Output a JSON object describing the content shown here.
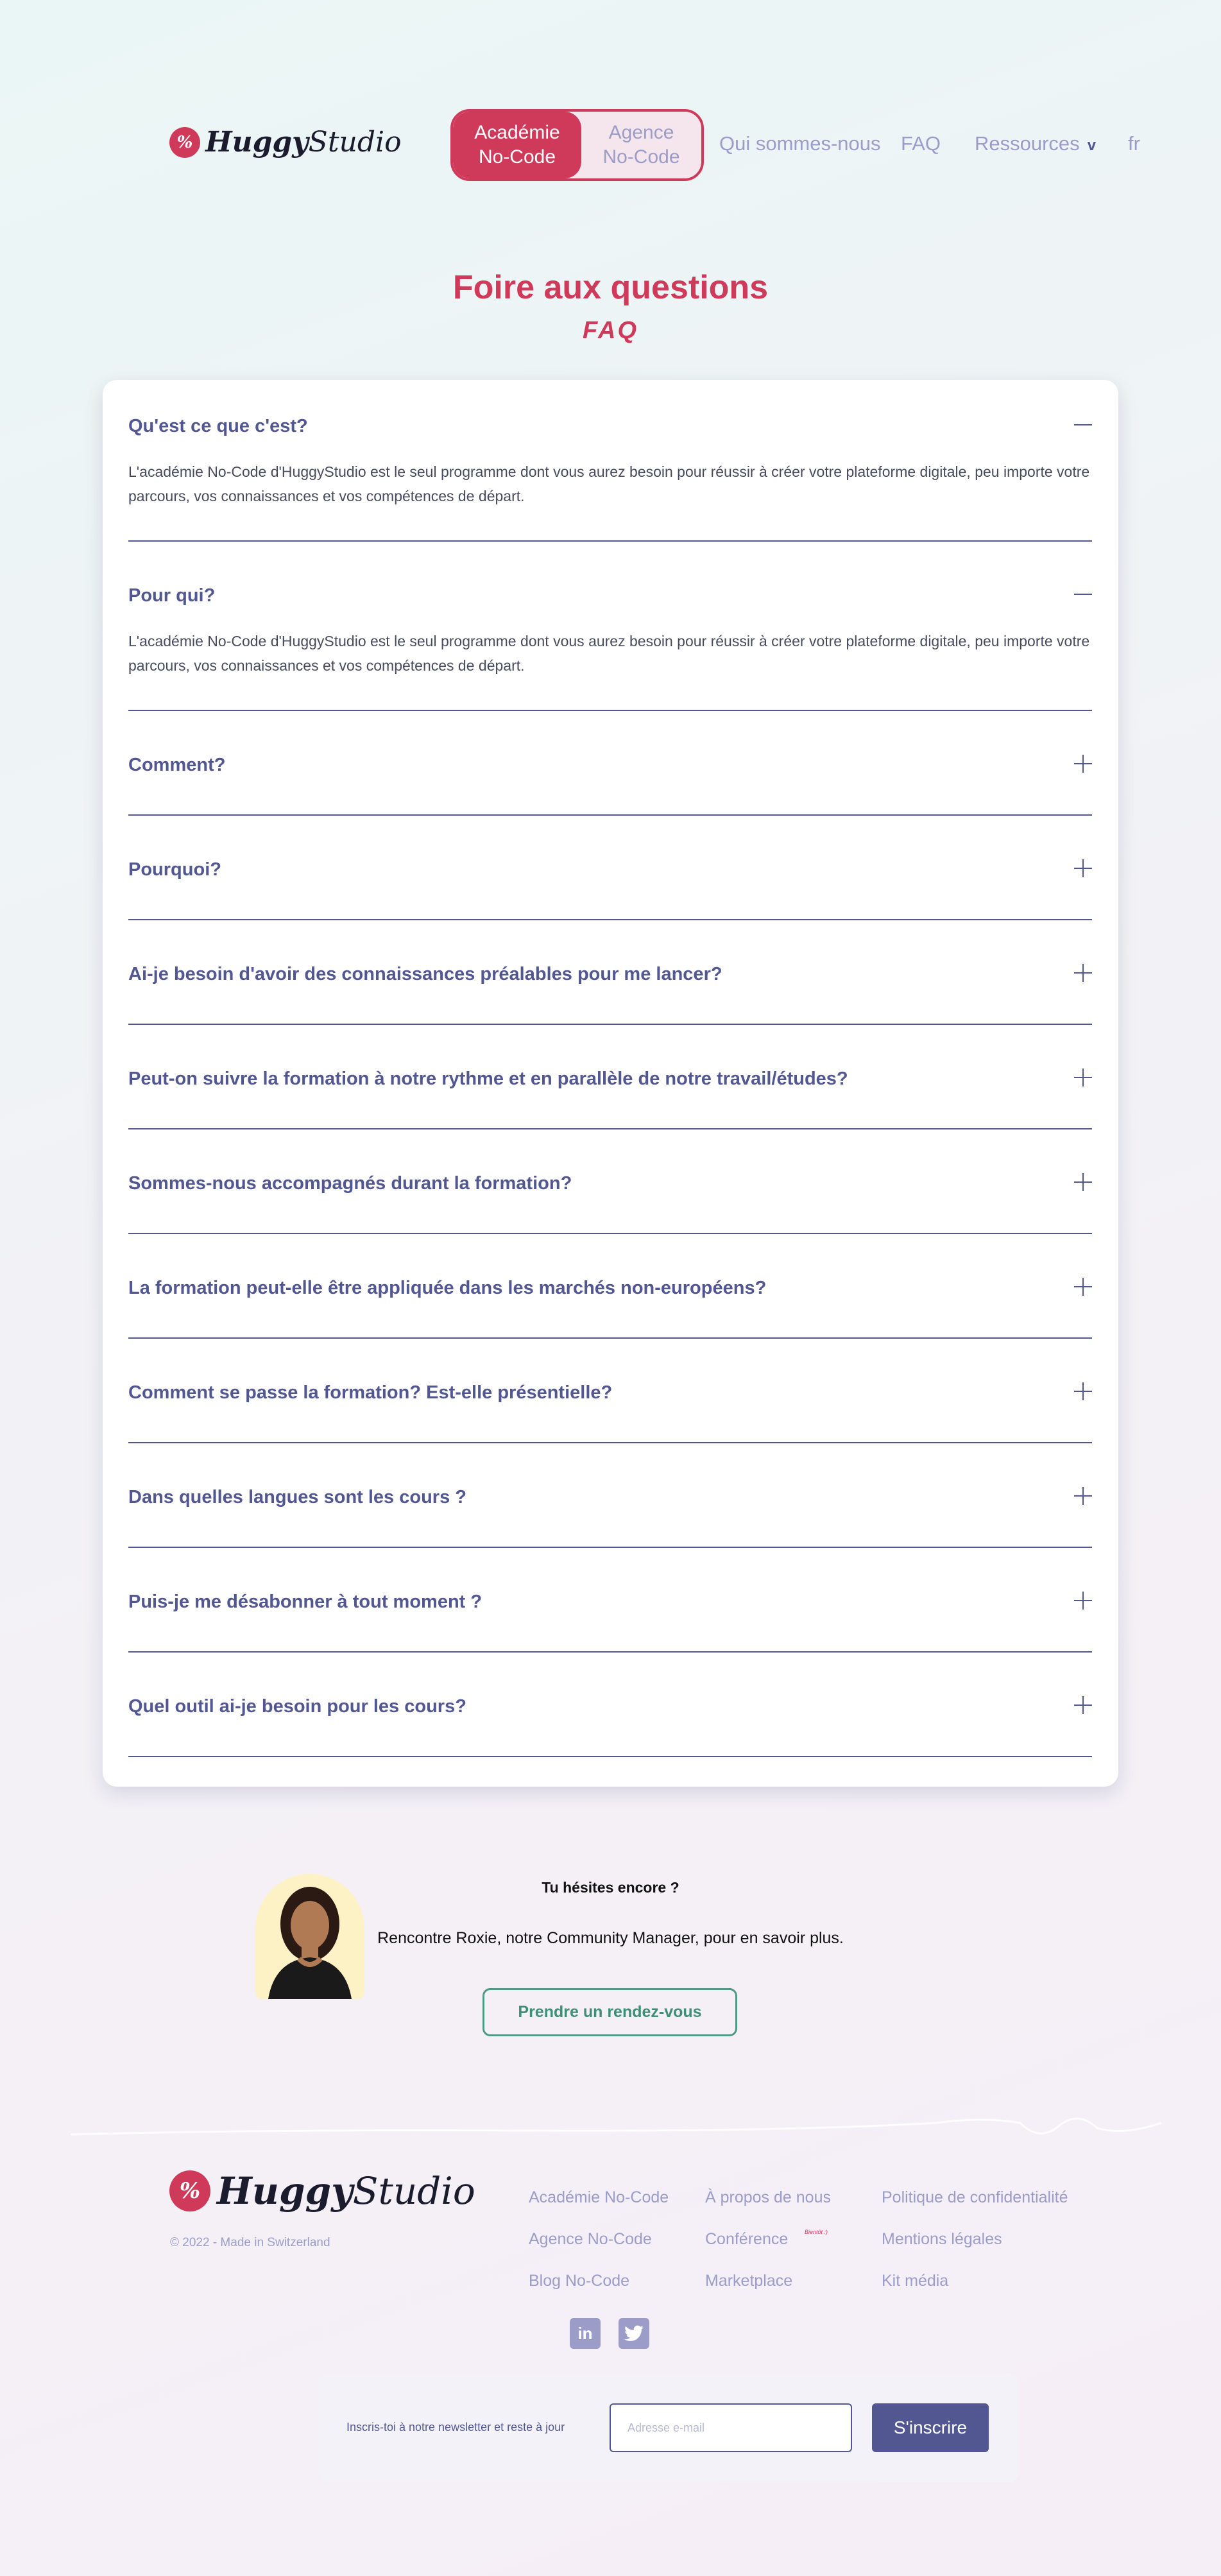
{
  "header": {
    "logo_mark": "%",
    "logo_bold": "Huggy",
    "logo_light": "Studio",
    "toggle": {
      "active_line1": "Académie",
      "active_line2": "No-Code",
      "inactive_line1": "Agence",
      "inactive_line2": "No-Code"
    },
    "nav": {
      "about": "Qui sommes-nous",
      "faq": "FAQ",
      "resources": "Ressources",
      "resources_chevron": "v",
      "lang": "fr"
    }
  },
  "page": {
    "title": "Foire aux questions",
    "subtitle": "FAQ"
  },
  "faq": {
    "items": [
      {
        "q": "Qu'est ce que c'est?",
        "open": true,
        "a": "L'académie No-Code d'HuggyStudio est le seul programme dont vous aurez besoin pour réussir à créer votre plateforme digitale, peu importe votre parcours, vos connaissances et vos compétences de départ."
      },
      {
        "q": "Pour qui?",
        "open": true,
        "a": "L'académie No-Code d'HuggyStudio est le seul programme dont vous aurez besoin pour réussir à créer votre plateforme digitale, peu importe votre parcours, vos connaissances et vos compétences de départ."
      },
      {
        "q": "Comment?",
        "open": false
      },
      {
        "q": "Pourquoi?",
        "open": false
      },
      {
        "q": "Ai-je besoin d'avoir des connaissances préalables pour me lancer?",
        "open": false
      },
      {
        "q": "Peut-on suivre la formation à notre rythme et en parallèle de notre travail/études?",
        "open": false
      },
      {
        "q": "Sommes-nous accompagnés durant la formation?",
        "open": false
      },
      {
        "q": "La formation peut-elle être appliquée dans les marchés non-européens?",
        "open": false
      },
      {
        "q": "Comment se passe la formation? Est-elle présentielle?",
        "open": false
      },
      {
        "q": "Dans quelles langues sont les cours ?",
        "open": false
      },
      {
        "q": "Puis-je me désabonner à tout moment ?",
        "open": false
      },
      {
        "q": "Quel outil ai-je besoin pour les cours?",
        "open": false
      }
    ]
  },
  "contact": {
    "title": "Tu hésites encore ?",
    "text": "Rencontre Roxie, notre Community Manager, pour en savoir plus.",
    "button": "Prendre un rendez-vous"
  },
  "footer": {
    "copyright": "© 2022 - Made in Switzerland",
    "links": {
      "academy": "Académie No-Code",
      "agency": "Agence No-Code",
      "blog": "Blog No-Code",
      "about": "À propos de nous",
      "conference": "Conférence",
      "conference_badge": "Bientôt :)",
      "marketplace": "Marketplace",
      "privacy": "Politique de confidentialité",
      "legal": "Mentions légales",
      "media": "Kit média"
    },
    "social": {
      "linkedin": "in",
      "twitter": "t"
    },
    "newsletter": {
      "label": "Inscris-toi à notre newsletter et reste à jour",
      "placeholder": "Adresse e-mail",
      "button": "S'inscrire"
    }
  },
  "colors": {
    "accent": "#cf3a5a",
    "primary": "#525792",
    "muted": "#9b9cc8",
    "green": "#4e9a82"
  }
}
